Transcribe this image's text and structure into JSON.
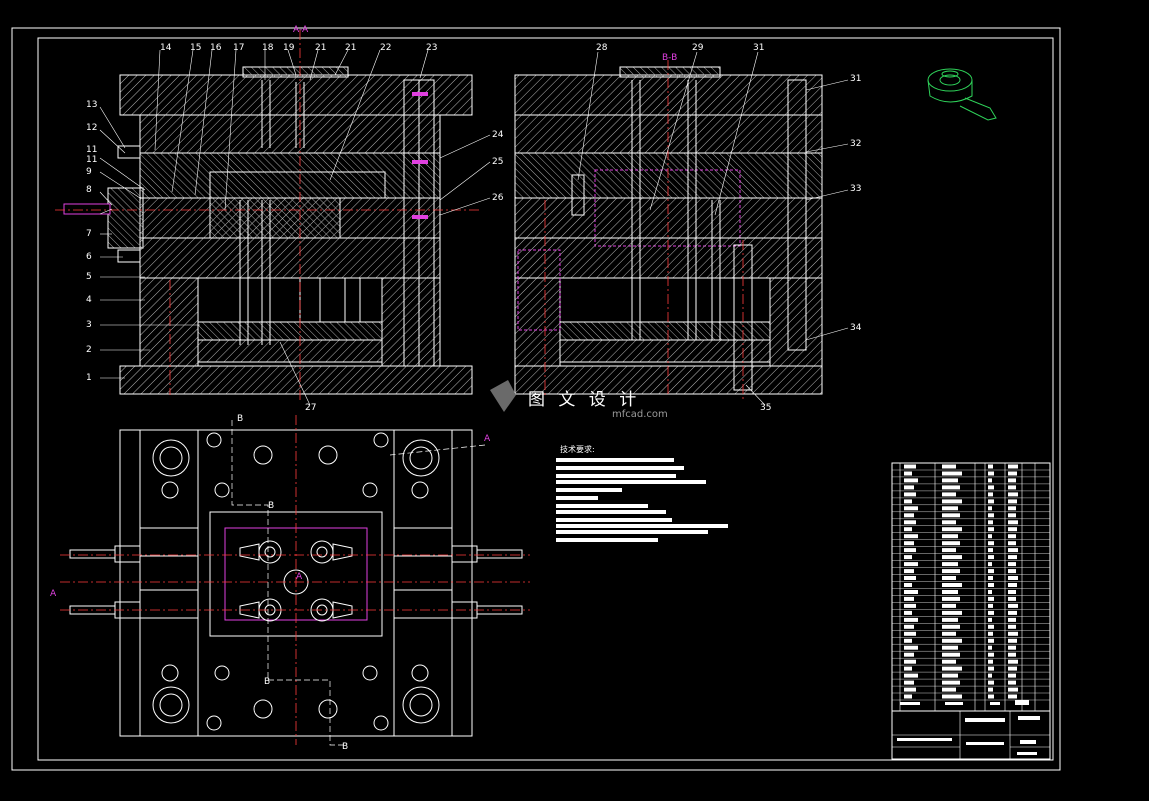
{
  "drawing": {
    "section_aa_label": "A-A",
    "section_bb_label": "B-B",
    "view_markers": [
      "A",
      "A",
      "A",
      "B",
      "B",
      "B",
      "B"
    ],
    "left_callouts": [
      "14",
      "15",
      "16",
      "17",
      "18",
      "19",
      "21",
      "21",
      "22",
      "23",
      "13",
      "12",
      "11",
      "11",
      "9",
      "8",
      "7",
      "6",
      "5",
      "4",
      "3",
      "2",
      "1",
      "24",
      "25",
      "26",
      "27"
    ],
    "right_callouts": [
      "28",
      "29",
      "31",
      "31",
      "32",
      "33",
      "34",
      "35"
    ],
    "tech_requirements_title": "技术要求:",
    "watermark_cn": "图 文 设 计",
    "watermark_en": "mfcad.com"
  },
  "colors": {
    "background": "#000000",
    "outline": "#ffffff",
    "hatch": "#bdbdbd",
    "centerline": "#ff3b3b",
    "dimension": "#e040e0",
    "part_view": "#2fd35a",
    "frame": "#ffffff"
  }
}
